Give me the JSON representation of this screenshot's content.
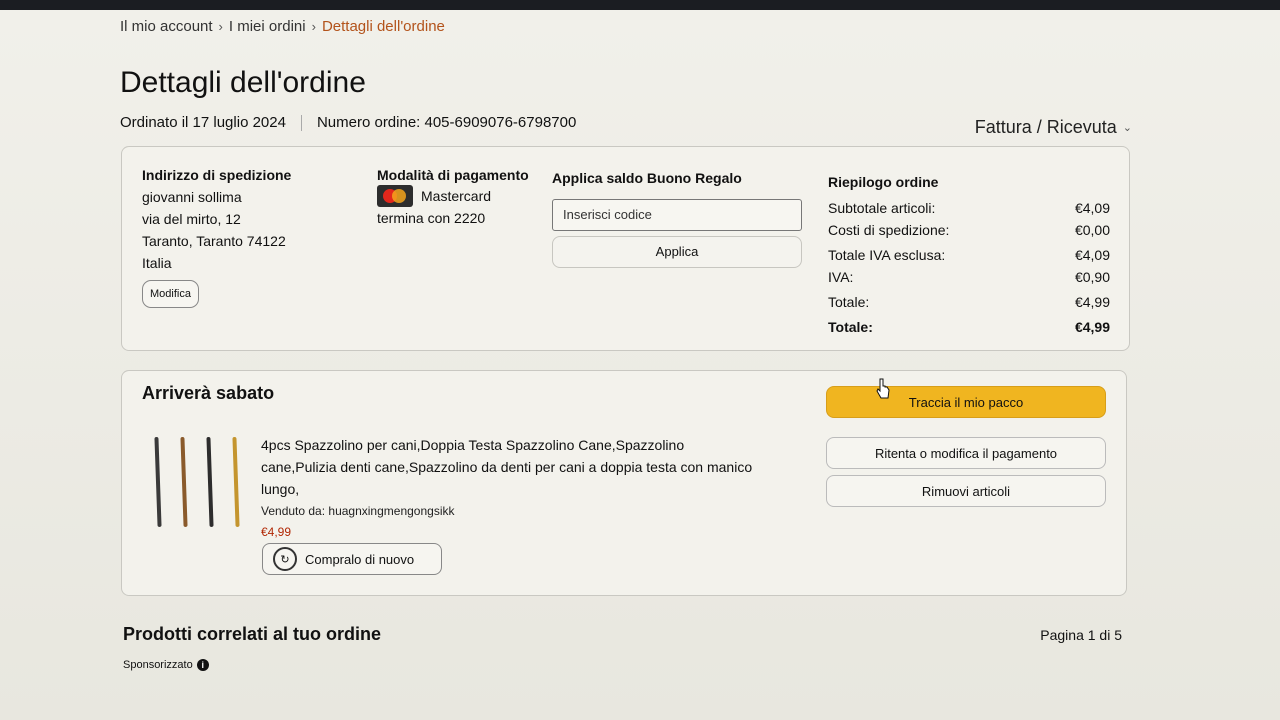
{
  "breadcrumb": {
    "items": [
      "Il mio account",
      "I miei ordini"
    ],
    "current": "Dettagli dell'ordine",
    "separator": "›"
  },
  "page_title": "Dettagli dell'ordine",
  "order_meta": {
    "ordered_on": "Ordinato il 17 luglio 2024",
    "order_number": "Numero ordine: 405-6909076-6798700"
  },
  "invoice_menu": {
    "label": "Fattura / Ricevuta",
    "icon": "chevron-down-icon"
  },
  "shipping": {
    "heading": "Indirizzo di spedizione",
    "lines": [
      "giovanni sollima",
      "via del mirto, 12",
      "Taranto, Taranto 74122",
      "Italia"
    ],
    "edit_label": "Modifica"
  },
  "payment": {
    "heading": "Modalità di pagamento",
    "card_brand": "Mastercard",
    "card_icon": "mastercard-icon",
    "card_ending": "termina con 2220"
  },
  "gift": {
    "heading": "Applica saldo Buono Regalo",
    "input_placeholder": "Inserisci codice",
    "apply_label": "Applica"
  },
  "summary": {
    "heading": "Riepilogo ordine",
    "rows": [
      {
        "label": "Subtotale articoli:",
        "value": "€4,09"
      },
      {
        "label": "Costi di spedizione:",
        "value": "€0,00"
      },
      {
        "label": "Totale IVA esclusa:",
        "value": "€4,09"
      },
      {
        "label": "IVA:",
        "value": "€0,90"
      },
      {
        "label": "Totale:",
        "value": "€4,99"
      }
    ],
    "grand_total": {
      "label": "Totale:",
      "value": "€4,99"
    }
  },
  "shipment": {
    "status": "Arriverà sabato",
    "product_title": "4pcs Spazzolino per cani,Doppia Testa Spazzolino Cane,Spazzolino cane,Pulizia denti cane,Spazzolino da denti per cani a doppia testa con manico lungo,",
    "seller": "Venduto da: huagnxingmengongsikk",
    "price": "€4,99",
    "buy_again_label": "Compralo di nuovo",
    "actions": {
      "track": "Traccia il mio pacco",
      "retry_payment": "Ritenta o modifica il pagamento",
      "remove": "Rimuovi articoli"
    }
  },
  "related": {
    "heading": "Prodotti correlati al tuo ordine",
    "pager": "Pagina 1 di 5",
    "sponsored": "Sponsorizzato",
    "sponsored_icon": "info-icon"
  },
  "colors": {
    "accent_link": "#b3531b",
    "track_button": "#f0b520",
    "price": "#b12704"
  }
}
